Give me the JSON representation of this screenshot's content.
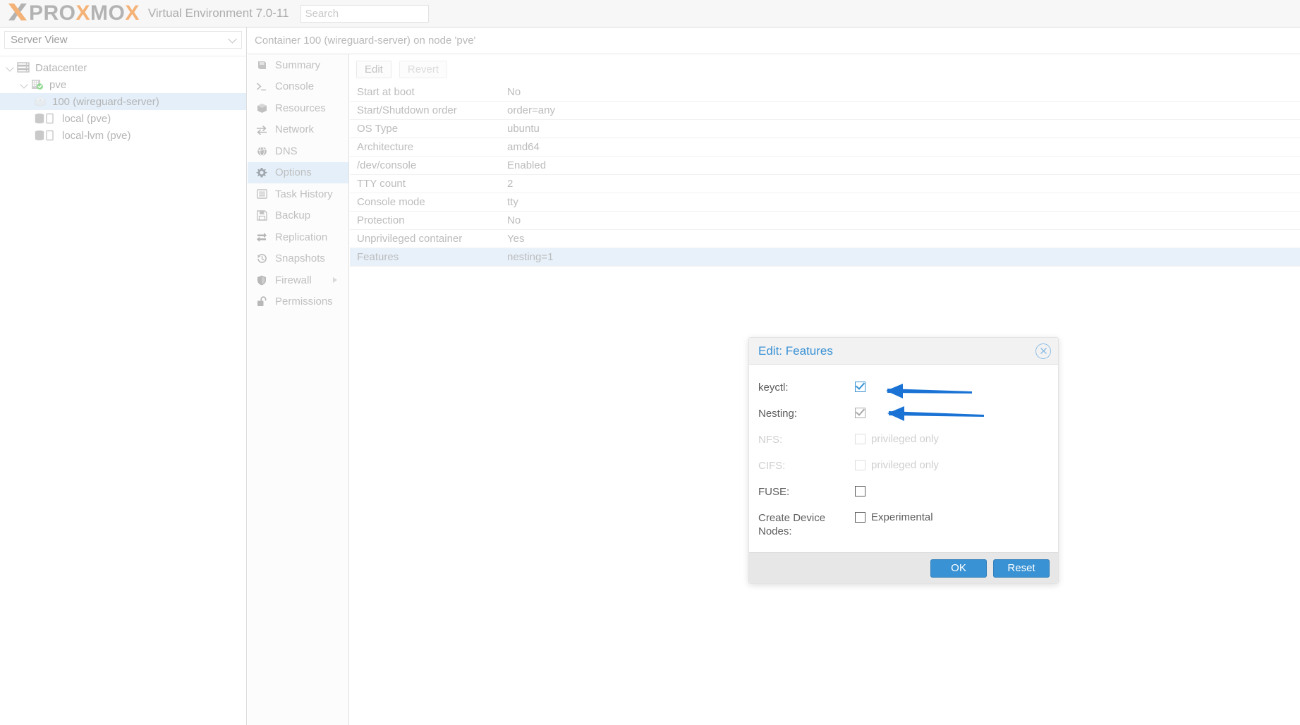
{
  "topbar": {
    "logo_x": "X",
    "logo_parts": [
      "PRO",
      "X",
      "MO",
      "X"
    ],
    "product": "Virtual Environment 7.0-11",
    "search_placeholder": "Search"
  },
  "sidebar": {
    "view_selector": "Server View",
    "tree": [
      {
        "label": "Datacenter",
        "icon": "datacenter-icon",
        "indent": 0,
        "expandable": true,
        "selected": false
      },
      {
        "label": "pve",
        "icon": "node-icon",
        "indent": 1,
        "expandable": true,
        "selected": false
      },
      {
        "label": "100 (wireguard-server)",
        "icon": "container-icon",
        "indent": 2,
        "expandable": false,
        "selected": true
      },
      {
        "label": "local (pve)",
        "icon": "storage-icon",
        "indent": 2,
        "expandable": false,
        "selected": false
      },
      {
        "label": "local-lvm (pve)",
        "icon": "storage-icon",
        "indent": 2,
        "expandable": false,
        "selected": false
      }
    ]
  },
  "header": {
    "title": "Container 100 (wireguard-server) on node 'pve'"
  },
  "nav": {
    "items": [
      {
        "label": "Summary",
        "icon": "book-icon",
        "active": false,
        "submenu": false
      },
      {
        "label": "Console",
        "icon": "terminal-icon",
        "active": false,
        "submenu": false
      },
      {
        "label": "Resources",
        "icon": "cube-icon",
        "active": false,
        "submenu": false
      },
      {
        "label": "Network",
        "icon": "network-icon",
        "active": false,
        "submenu": false
      },
      {
        "label": "DNS",
        "icon": "globe-icon",
        "active": false,
        "submenu": false
      },
      {
        "label": "Options",
        "icon": "gear-icon",
        "active": true,
        "submenu": false
      },
      {
        "label": "Task History",
        "icon": "list-icon",
        "active": false,
        "submenu": false
      },
      {
        "label": "Backup",
        "icon": "floppy-icon",
        "active": false,
        "submenu": false
      },
      {
        "label": "Replication",
        "icon": "replication-icon",
        "active": false,
        "submenu": false
      },
      {
        "label": "Snapshots",
        "icon": "history-icon",
        "active": false,
        "submenu": false
      },
      {
        "label": "Firewall",
        "icon": "shield-icon",
        "active": false,
        "submenu": true
      },
      {
        "label": "Permissions",
        "icon": "unlock-icon",
        "active": false,
        "submenu": false
      }
    ]
  },
  "toolbar": {
    "edit_label": "Edit",
    "revert_label": "Revert"
  },
  "options_table": {
    "rows": [
      {
        "key": "Start at boot",
        "value": "No",
        "selected": false
      },
      {
        "key": "Start/Shutdown order",
        "value": "order=any",
        "selected": false
      },
      {
        "key": "OS Type",
        "value": "ubuntu",
        "selected": false
      },
      {
        "key": "Architecture",
        "value": "amd64",
        "selected": false
      },
      {
        "key": "/dev/console",
        "value": "Enabled",
        "selected": false
      },
      {
        "key": "TTY count",
        "value": "2",
        "selected": false
      },
      {
        "key": "Console mode",
        "value": "tty",
        "selected": false
      },
      {
        "key": "Protection",
        "value": "No",
        "selected": false
      },
      {
        "key": "Unprivileged container",
        "value": "Yes",
        "selected": false
      },
      {
        "key": "Features",
        "value": "nesting=1",
        "selected": true
      }
    ]
  },
  "dialog": {
    "title": "Edit: Features",
    "close_icon": "close-icon",
    "fields": [
      {
        "label": "keyctl:",
        "checked": true,
        "disabled": false,
        "style": "blue",
        "note": ""
      },
      {
        "label": "Nesting:",
        "checked": true,
        "disabled": false,
        "style": "gray",
        "note": ""
      },
      {
        "label": "NFS:",
        "checked": false,
        "disabled": true,
        "style": "dis",
        "note": "privileged only"
      },
      {
        "label": "CIFS:",
        "checked": false,
        "disabled": true,
        "style": "dis",
        "note": "privileged only"
      },
      {
        "label": "FUSE:",
        "checked": false,
        "disabled": false,
        "style": "",
        "note": ""
      },
      {
        "label": "Create Device Nodes:",
        "checked": false,
        "disabled": false,
        "style": "",
        "note": "Experimental"
      }
    ],
    "ok_label": "OK",
    "reset_label": "Reset"
  },
  "annotations": {
    "arrow_color": "#1a73d4",
    "arrows": [
      {
        "name": "arrow-to-keyctl-checkbox"
      },
      {
        "name": "arrow-to-nesting-checkbox"
      }
    ]
  },
  "colors": {
    "accent_blue": "#3892d4",
    "selection_blue": "#e4eff9",
    "logo_orange": "#f5b277",
    "logo_gray": "#b3b3b3"
  }
}
